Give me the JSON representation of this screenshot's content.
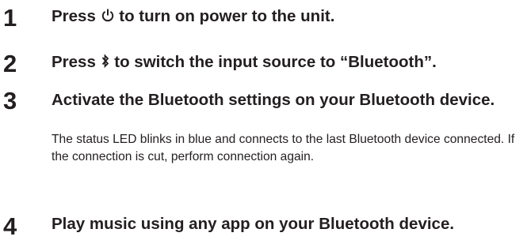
{
  "steps": [
    {
      "number": "1",
      "text_before": "Press",
      "icon": "power-icon",
      "text_after": "to turn on power to the unit."
    },
    {
      "number": "2",
      "text_before": "Press",
      "icon": "bluetooth-icon",
      "text_after": "to switch the input source to “Bluetooth”."
    },
    {
      "number": "3",
      "heading": "Activate the Bluetooth settings on your Bluetooth device.",
      "body": "The status LED blinks in blue and connects to the last Bluetooth device connected. If the connection is cut, perform connection again."
    },
    {
      "number": "4",
      "heading": "Play music using any app on your Bluetooth device."
    }
  ],
  "colors": {
    "text": "#231f20",
    "background": "#ffffff"
  }
}
